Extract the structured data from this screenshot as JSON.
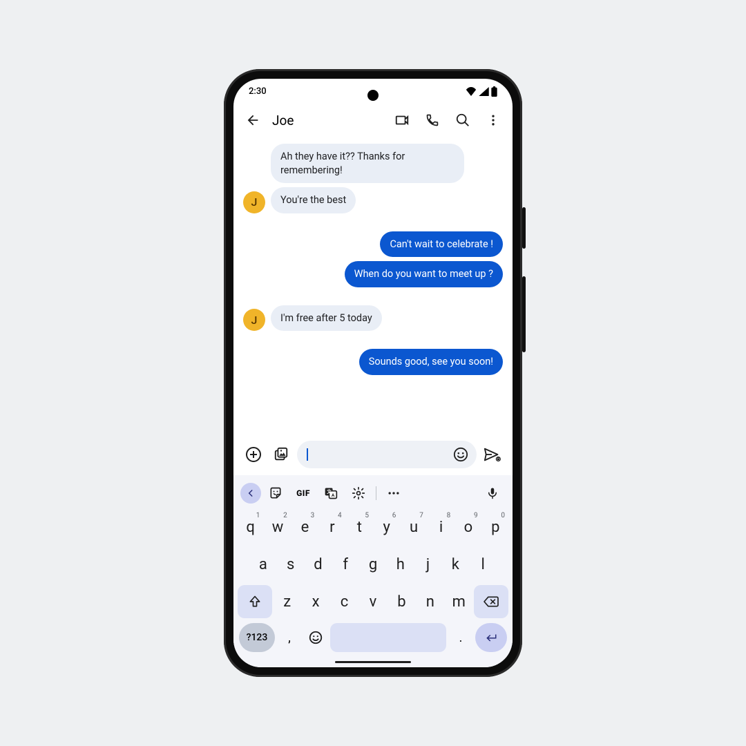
{
  "status": {
    "time": "2:30"
  },
  "header": {
    "contact_name": "Joe",
    "contact_initial": "J"
  },
  "messages": [
    {
      "dir": "in",
      "show_avatar": false,
      "text": "Ah they have it?? Thanks for remembering!"
    },
    {
      "dir": "in",
      "show_avatar": true,
      "text": "You're the best"
    },
    {
      "dir": "gap"
    },
    {
      "dir": "out",
      "text": "Can't wait to celebrate !"
    },
    {
      "dir": "out",
      "text": "When do you want to meet up ?"
    },
    {
      "dir": "gap"
    },
    {
      "dir": "in",
      "show_avatar": true,
      "text": "I'm free after 5 today"
    },
    {
      "dir": "gap"
    },
    {
      "dir": "out",
      "text": "Sounds good, see you soon!"
    }
  ],
  "composer": {
    "placeholder": ""
  },
  "keyboard": {
    "row1": [
      {
        "k": "q",
        "s": "1"
      },
      {
        "k": "w",
        "s": "2"
      },
      {
        "k": "e",
        "s": "3"
      },
      {
        "k": "r",
        "s": "4"
      },
      {
        "k": "t",
        "s": "5"
      },
      {
        "k": "y",
        "s": "6"
      },
      {
        "k": "u",
        "s": "7"
      },
      {
        "k": "i",
        "s": "8"
      },
      {
        "k": "o",
        "s": "9"
      },
      {
        "k": "p",
        "s": "0"
      }
    ],
    "row2": [
      "a",
      "s",
      "d",
      "f",
      "g",
      "h",
      "j",
      "k",
      "l"
    ],
    "row3": [
      "z",
      "x",
      "c",
      "v",
      "b",
      "n",
      "m"
    ],
    "numeric_label": "?123",
    "comma": ",",
    "period": ".",
    "gif_label": "GIF"
  }
}
